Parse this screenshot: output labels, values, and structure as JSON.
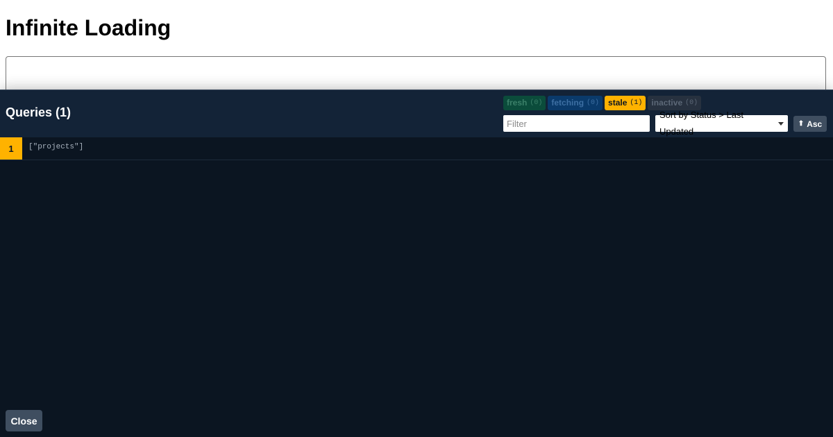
{
  "page": {
    "title": "Infinite Loading"
  },
  "devtools": {
    "title": "Queries (1)",
    "statuses": [
      {
        "label": "fresh",
        "count": "(0)"
      },
      {
        "label": "fetching",
        "count": "(0)"
      },
      {
        "label": "stale",
        "count": "(1)"
      },
      {
        "label": "inactive",
        "count": "(0)"
      }
    ],
    "filter_placeholder": "Filter",
    "filter_value": "",
    "sort_selected": "Sort by Status > Last Updated",
    "order_label": "Asc",
    "order_arrow": "⬆",
    "queries": [
      {
        "observers": "1",
        "key": "[\"projects\"]"
      }
    ],
    "close_label": "Close"
  },
  "colors": {
    "panel_bg": "#0b1521",
    "header_bg": "#132337",
    "stale": "#ffb200",
    "fresh": "#0b4c3b",
    "fetching": "#0a3a6b",
    "inactive": "#27313f",
    "button": "#3f4e60"
  }
}
